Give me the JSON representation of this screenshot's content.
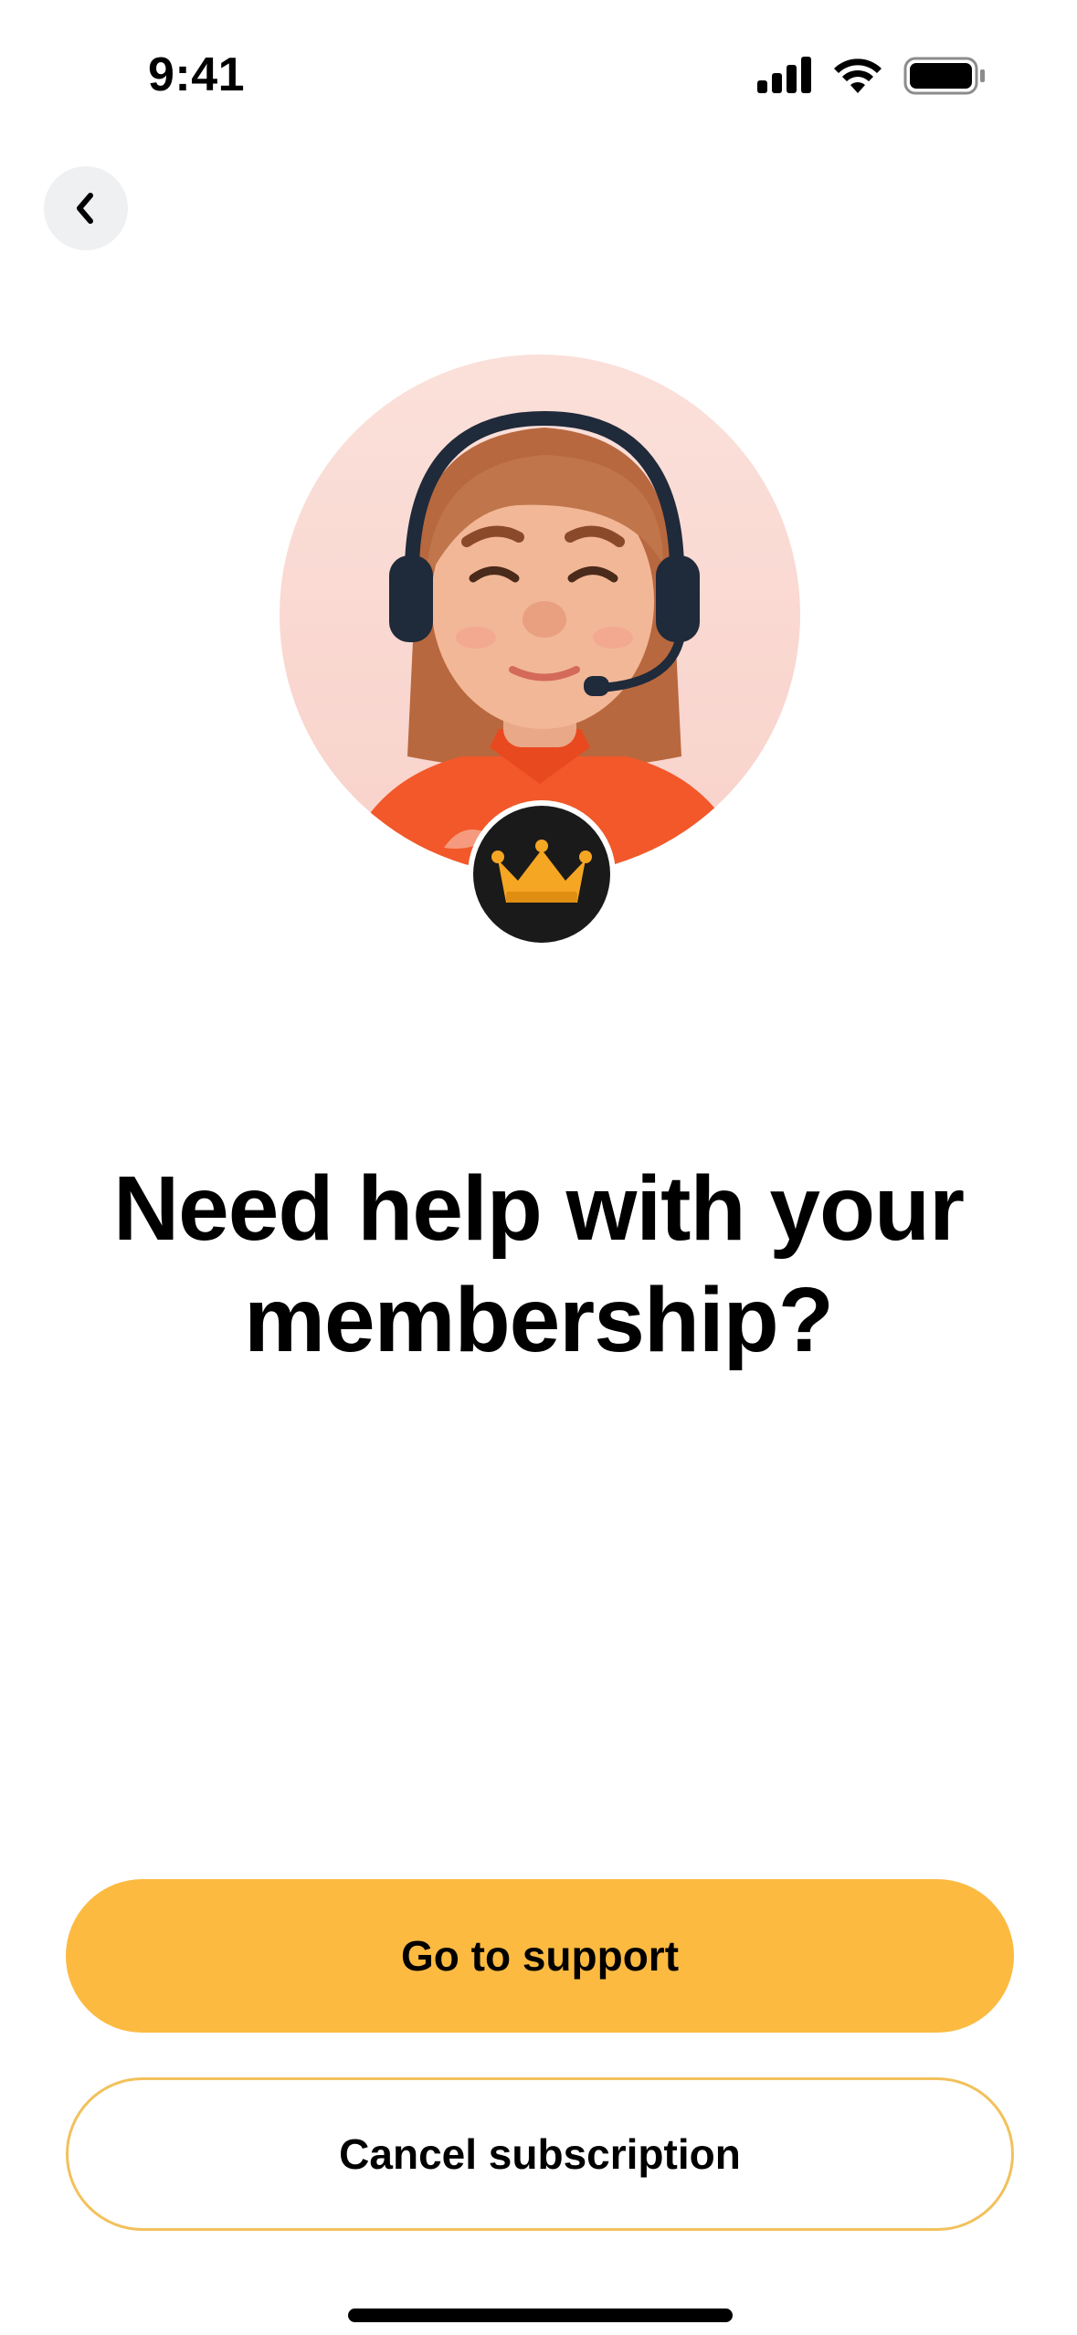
{
  "status_bar": {
    "time": "9:41",
    "icons": [
      "cellular-signal-icon",
      "wifi-icon",
      "battery-icon"
    ]
  },
  "nav": {
    "back_icon": "chevron-left-icon"
  },
  "illustration": {
    "subject": "support-agent-avatar",
    "badge_icon": "crown-icon",
    "circle_color": "#fadcd6",
    "badge_color": "#1a1a1a",
    "crown_color": "#f5a623"
  },
  "headline": {
    "line1": "Need help with your",
    "line2": "membership?"
  },
  "actions": {
    "primary_label": "Go to support",
    "secondary_label": "Cancel subscription",
    "primary_color": "#fcba41",
    "secondary_border_color": "#f2c15c"
  }
}
